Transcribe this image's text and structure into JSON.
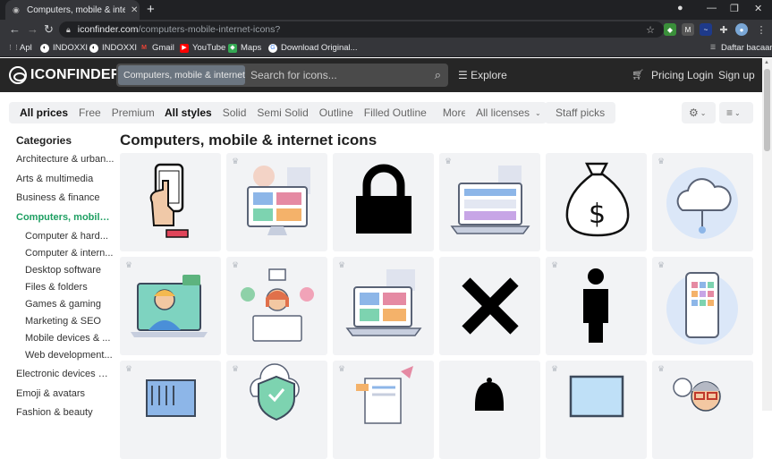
{
  "browser": {
    "tab_title": "Computers, mobile & internet ic",
    "url_host": "iconfinder.com",
    "url_path": "/computers-mobile-internet-icons?",
    "bookmarks": [
      "Apl",
      "INDOXXI",
      "INDOXXI",
      "Gmail",
      "YouTube",
      "Maps",
      "Download Original..."
    ],
    "reading_list": "Daftar bacaan"
  },
  "header": {
    "logo": "ICONFINDER",
    "category_select": "Computers, mobile & internet",
    "search_placeholder": "Search for icons...",
    "explore": "Explore",
    "pricing": "Pricing",
    "login": "Login",
    "signup": "Sign up"
  },
  "filters": {
    "price": [
      "All prices",
      "Free",
      "Premium"
    ],
    "style": [
      "All styles",
      "Solid",
      "Semi Solid",
      "Outline",
      "Filled Outline",
      "More"
    ],
    "licenses": "All licenses",
    "staff_picks": "Staff picks"
  },
  "sidebar": {
    "heading": "Categories",
    "items": [
      {
        "label": "Architecture & urban...",
        "sub": false,
        "active": false
      },
      {
        "label": "Arts & multimedia",
        "sub": false,
        "active": false
      },
      {
        "label": "Business & finance",
        "sub": false,
        "active": false
      },
      {
        "label": "Computers, mobile ...",
        "sub": false,
        "active": true
      },
      {
        "label": "Computer & hard...",
        "sub": true,
        "active": false
      },
      {
        "label": "Computer & intern...",
        "sub": true,
        "active": false
      },
      {
        "label": "Desktop software",
        "sub": true,
        "active": false
      },
      {
        "label": "Files & folders",
        "sub": true,
        "active": false
      },
      {
        "label": "Games & gaming",
        "sub": true,
        "active": false
      },
      {
        "label": "Marketing & SEO",
        "sub": true,
        "active": false
      },
      {
        "label": "Mobile devices & ...",
        "sub": true,
        "active": false
      },
      {
        "label": "Web development...",
        "sub": true,
        "active": false
      },
      {
        "label": "Electronic devices & ...",
        "sub": false,
        "active": false
      },
      {
        "label": "Emoji & avatars",
        "sub": false,
        "active": false
      },
      {
        "label": "Fashion & beauty",
        "sub": false,
        "active": false
      }
    ]
  },
  "main": {
    "title": "Computers, mobile & internet icons",
    "icons": [
      "hand-phone-icon",
      "desktop-monitor-icon",
      "padlock-icon",
      "laptop-browser-icon",
      "money-bag-icon",
      "cloud-network-icon",
      "video-chat-icon",
      "email-team-icon",
      "laptop-dashboard-icon",
      "close-x-icon",
      "person-icon",
      "smartphone-apps-icon",
      "server-icon",
      "shield-check-icon",
      "document-icon",
      "bell-icon",
      "monitor-icon",
      "avatar-glasses-icon"
    ]
  },
  "colors": {
    "accent_green": "#1e9f62",
    "header_bg": "#262626",
    "tile_bg": "#f2f3f5"
  }
}
